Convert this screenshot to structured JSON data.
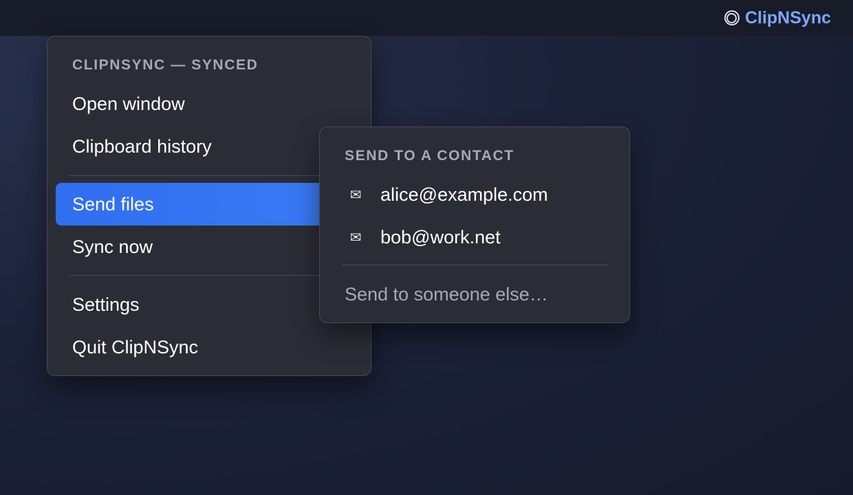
{
  "menubar": {
    "app_name": "ClipNSync",
    "icon": "sync-ring-icon"
  },
  "main_menu": {
    "header": "CLIPNSYNC — SYNCED",
    "items": [
      {
        "label": "Open window"
      },
      {
        "label": "Clipboard history"
      },
      {
        "label": "Send files",
        "active": true
      },
      {
        "label": "Sync now"
      },
      {
        "label": "Settings"
      },
      {
        "label": "Quit ClipNSync"
      }
    ]
  },
  "submenu": {
    "header": "SEND TO A CONTACT",
    "contacts": [
      {
        "label": "alice@example.com",
        "icon": "mail-icon"
      },
      {
        "label": "bob@work.net",
        "icon": "mail-icon"
      }
    ],
    "other_label": "Send to someone else…"
  },
  "colors": {
    "accent": "#2f6ff0",
    "tray_text": "#7ea6ff",
    "menu_bg": "#2b2d36"
  }
}
